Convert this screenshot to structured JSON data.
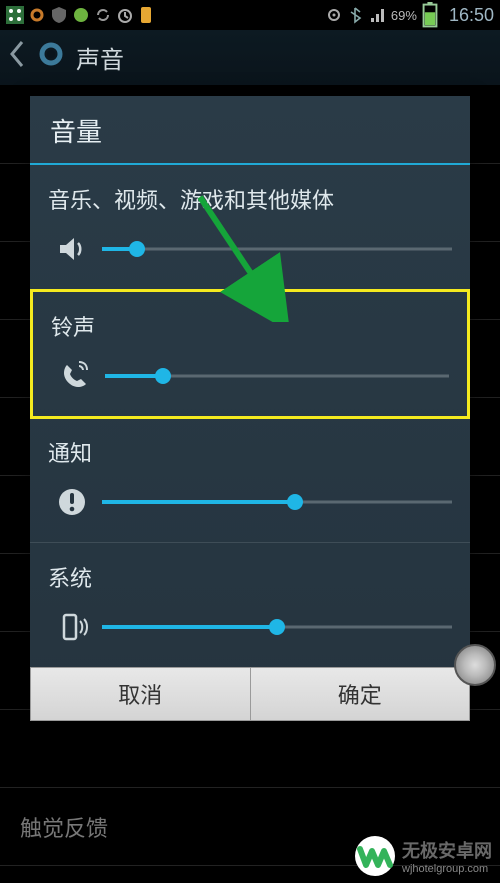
{
  "status": {
    "battery_percent": "69%",
    "time": "16:50"
  },
  "header": {
    "title": "声音"
  },
  "background": {
    "item_bottom": "触觉反馈"
  },
  "dialog": {
    "title": "音量",
    "sections": [
      {
        "label": "音乐、视频、游戏和其他媒体",
        "icon": "speaker-icon",
        "value_pct": 10
      },
      {
        "label": "铃声",
        "icon": "phone-icon",
        "value_pct": 17,
        "highlight": true
      },
      {
        "label": "通知",
        "icon": "alert-icon",
        "value_pct": 55
      },
      {
        "label": "系统",
        "icon": "vibrate-icon",
        "value_pct": 50
      }
    ],
    "buttons": {
      "cancel": "取消",
      "ok": "确定"
    }
  },
  "watermark": {
    "name": "无极安卓网",
    "url": "wjhotelgroup.com"
  },
  "colors": {
    "accent": "#1fb6e6",
    "highlight": "#f5ea1f",
    "arrow": "#15a53a"
  }
}
